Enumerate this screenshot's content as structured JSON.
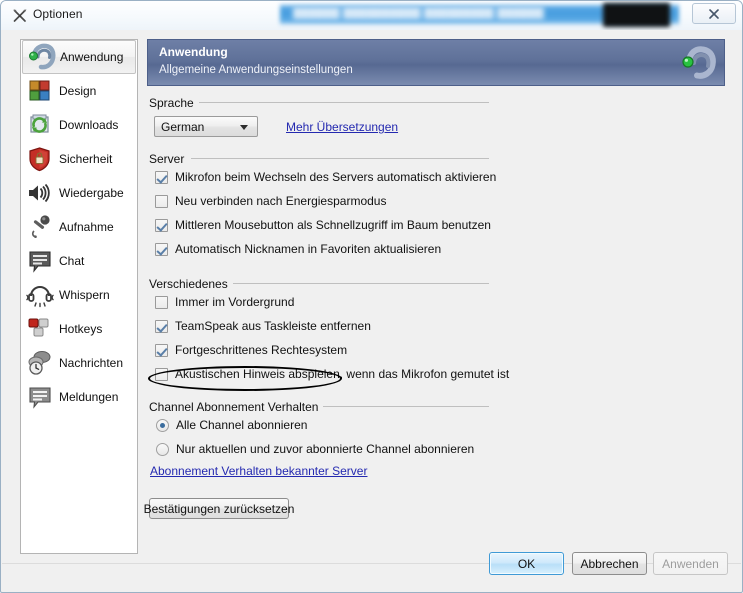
{
  "window": {
    "title": "Optionen",
    "title_icon": "tools-icon",
    "close_label": "✖",
    "redaction_placeholder": "██████ ██████████ █████████ ██████"
  },
  "sidebar": {
    "items": [
      {
        "label": "Anwendung",
        "icon": "headphone-logo-icon",
        "selected": true
      },
      {
        "label": "Design",
        "icon": "color-tiles-icon",
        "selected": false
      },
      {
        "label": "Downloads",
        "icon": "download-refresh-icon",
        "selected": false
      },
      {
        "label": "Sicherheit",
        "icon": "shield-lock-icon",
        "selected": false
      },
      {
        "label": "Wiedergabe",
        "icon": "speaker-icon",
        "selected": false
      },
      {
        "label": "Aufnahme",
        "icon": "microphone-icon",
        "selected": false
      },
      {
        "label": "Chat",
        "icon": "chat-bubble-icon",
        "selected": false
      },
      {
        "label": "Whispern",
        "icon": "headset-icon",
        "selected": false
      },
      {
        "label": "Hotkeys",
        "icon": "keyboard-keys-icon",
        "selected": false
      },
      {
        "label": "Nachrichten",
        "icon": "message-clock-icon",
        "selected": false
      },
      {
        "label": "Meldungen",
        "icon": "notification-bubble-icon",
        "selected": false
      }
    ]
  },
  "panel": {
    "title": "Anwendung",
    "subtitle": "Allgemeine Anwendungseinstellungen",
    "logo_icon": "teamspeak-logo-icon"
  },
  "groups": {
    "sprache": {
      "label": "Sprache",
      "combo_value": "German",
      "combo_options": [
        "German"
      ],
      "more_translations_link": "Mehr Übersetzungen"
    },
    "server": {
      "label": "Server",
      "checkboxes": [
        {
          "label": "Mikrofon beim Wechseln des Servers automatisch aktivieren",
          "checked": true
        },
        {
          "label": "Neu verbinden nach Energiesparmodus",
          "checked": false
        },
        {
          "label": "Mittleren Mousebutton als Schnellzugriff im Baum benutzen",
          "checked": true
        },
        {
          "label": "Automatisch Nicknamen in Favoriten aktualisieren",
          "checked": true
        }
      ]
    },
    "verschiedenes": {
      "label": "Verschiedenes",
      "checkboxes": [
        {
          "label": "Immer im Vordergrund",
          "checked": false
        },
        {
          "label": "TeamSpeak aus Taskleiste entfernen",
          "checked": true
        },
        {
          "label": "Fortgeschrittenes Rechtesystem",
          "checked": true,
          "highlighted": true
        },
        {
          "label": "Akustischen Hinweis abspielen, wenn das Mikrofon gemutet ist",
          "checked": false
        }
      ]
    },
    "channel": {
      "label": "Channel Abonnement Verhalten",
      "radios": [
        {
          "label": "Alle Channel abonnieren",
          "selected": true
        },
        {
          "label": "Nur aktuellen und zuvor abonnierte Channel abonnieren",
          "selected": false
        }
      ],
      "link": "Abonnement Verhalten bekannter Server",
      "reset_button": "Bestätigungen zurücksetzen"
    }
  },
  "footer": {
    "ok": "OK",
    "cancel": "Abbrechen",
    "apply": "Anwenden",
    "apply_disabled": true
  },
  "colors": {
    "panel_header": "#5f7199",
    "link": "#2429b0",
    "default_button_border": "#3f9ad6",
    "annotation": "#000000"
  }
}
